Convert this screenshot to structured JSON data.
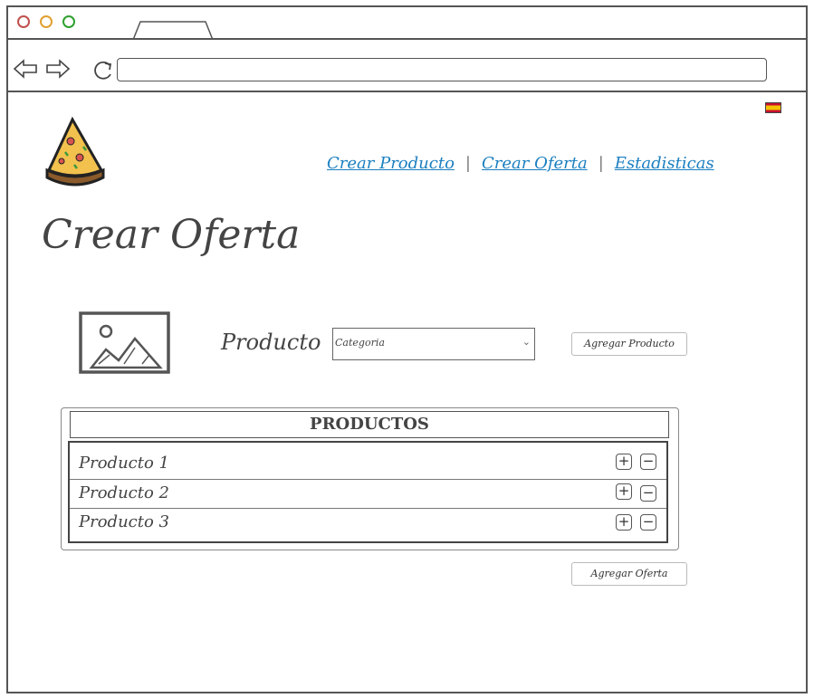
{
  "browser": {
    "dots": [
      {
        "name": "close-dot",
        "color": "#c0504d"
      },
      {
        "name": "minimize-dot",
        "color": "#e0a030"
      },
      {
        "name": "maximize-dot",
        "color": "#2ea02e"
      }
    ],
    "address": ""
  },
  "language": {
    "flag_icon": "spain-flag-icon"
  },
  "nav": {
    "links": [
      "Crear Producto",
      "Crear Oferta",
      "Estadisticas"
    ],
    "separator": "|"
  },
  "page": {
    "title": "Crear Oferta"
  },
  "form": {
    "product_label": "Producto",
    "category_value": "Categoria",
    "add_product_button": "Agregar Producto"
  },
  "products": {
    "header": "PRODUCTOS",
    "items": [
      "Producto 1",
      "Producto 2",
      "Producto 3"
    ],
    "plus_symbol": "+",
    "minus_symbol": "−"
  },
  "actions": {
    "add_offer_button": "Agregar Oferta"
  },
  "colors": {
    "link": "#1b7fc0",
    "border": "#555555"
  }
}
